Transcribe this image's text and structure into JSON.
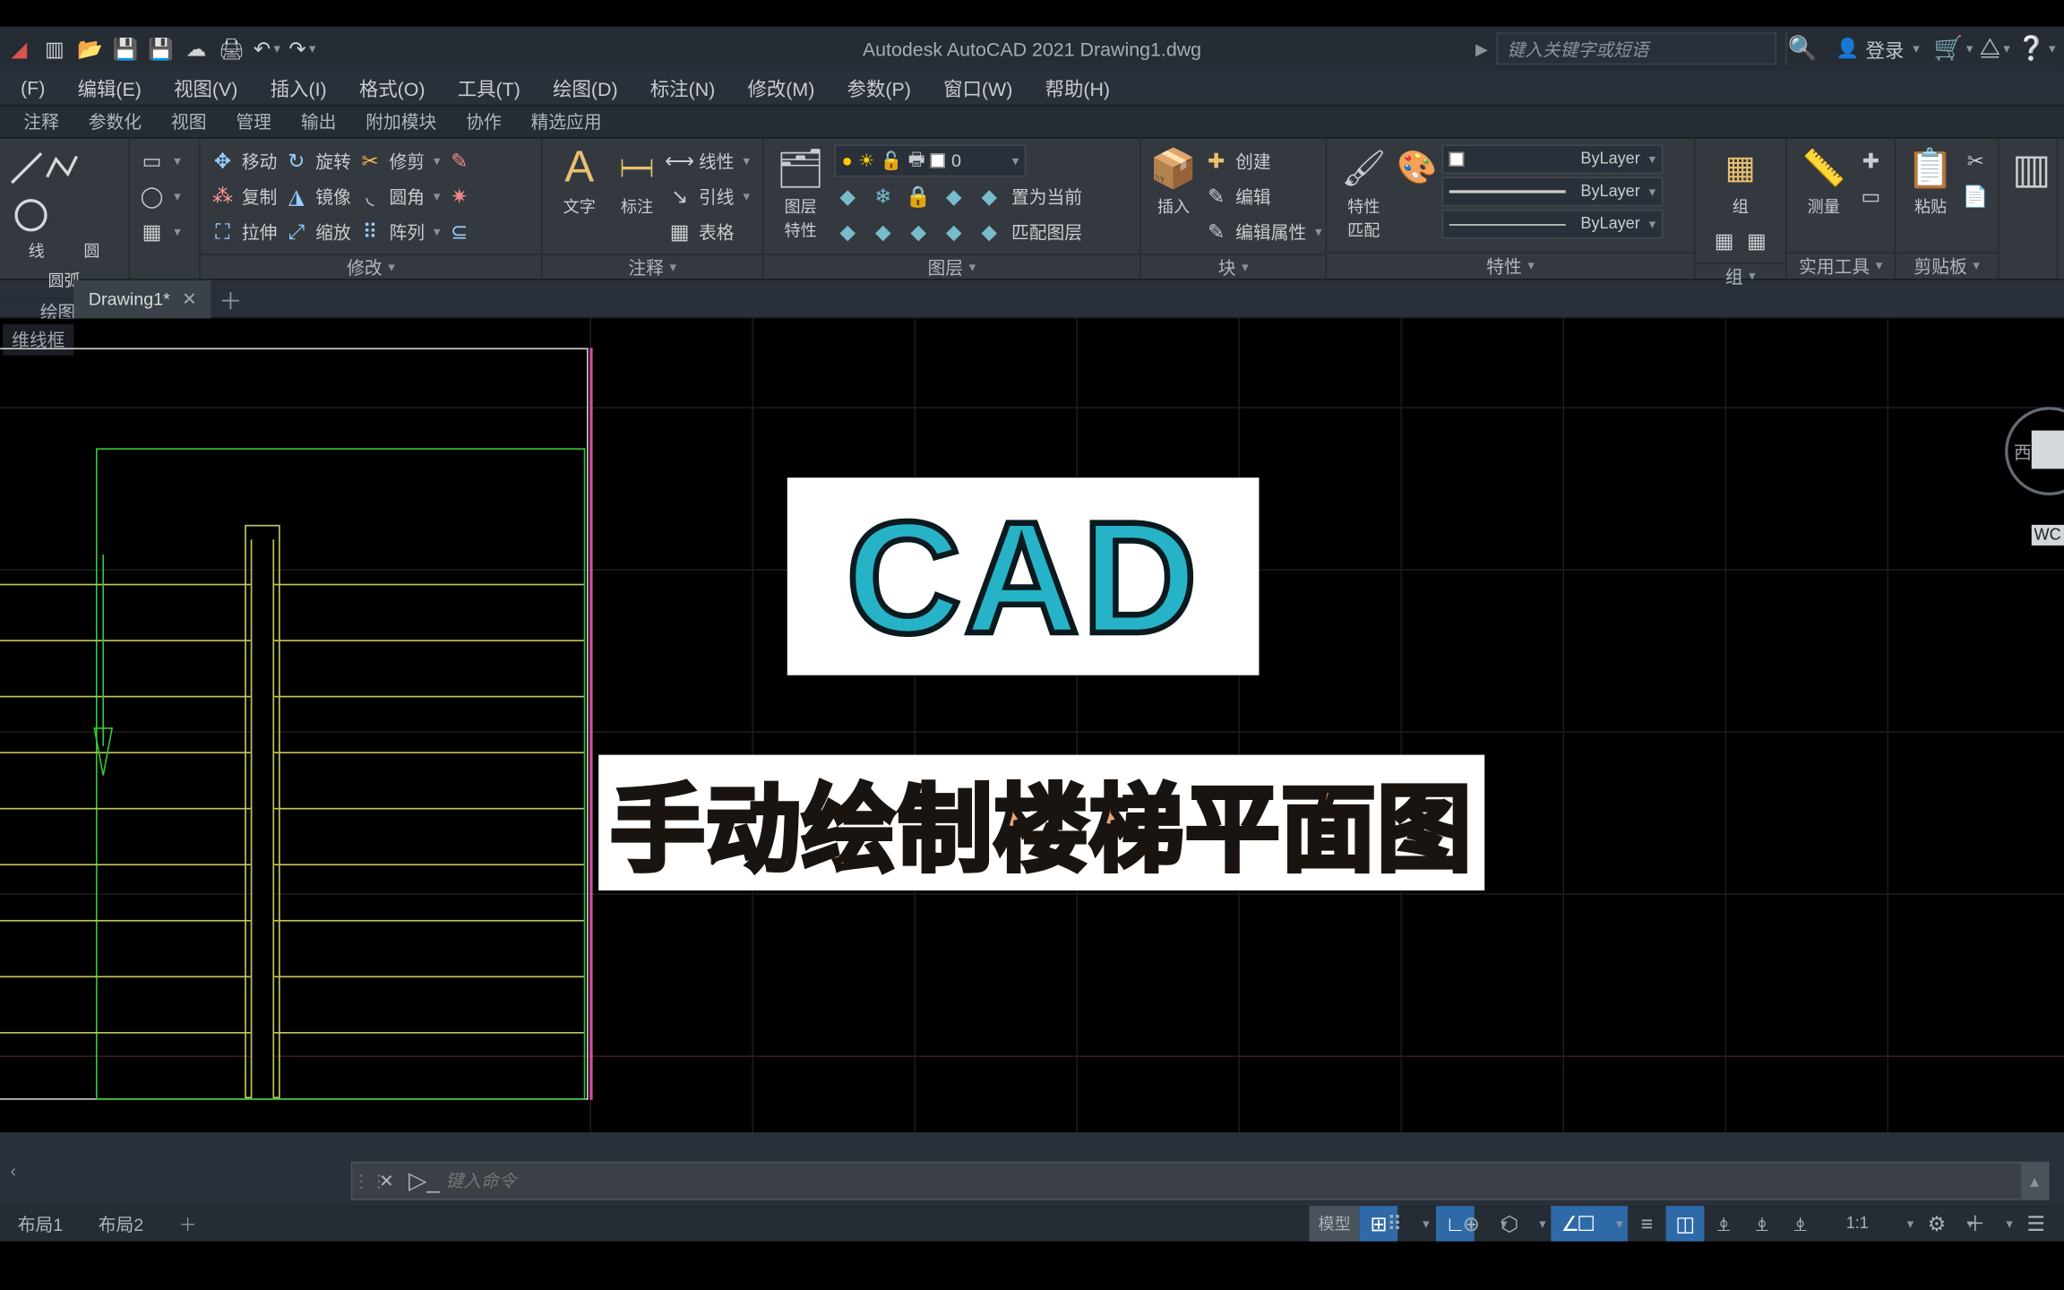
{
  "title": "Autodesk AutoCAD 2021   Drawing1.dwg",
  "search": {
    "placeholder": "键入关键字或短语",
    "login": "登录"
  },
  "menubar": [
    "(F)",
    "编辑(E)",
    "视图(V)",
    "插入(I)",
    "格式(O)",
    "工具(T)",
    "绘图(D)",
    "标注(N)",
    "修改(M)",
    "参数(P)",
    "窗口(W)",
    "帮助(H)"
  ],
  "ribtabs": [
    "注释",
    "参数化",
    "视图",
    "管理",
    "输出",
    "附加模块",
    "协作",
    "精选应用"
  ],
  "panels": {
    "draw": {
      "label": "绘图",
      "items": [
        "线",
        "圆",
        "圆弧"
      ]
    },
    "modify": {
      "label": "修改",
      "items": [
        {
          "icon": "move",
          "text": "移动"
        },
        {
          "icon": "rotate",
          "text": "旋转"
        },
        {
          "icon": "trim",
          "text": "修剪"
        },
        {
          "icon": "copy",
          "text": "复制"
        },
        {
          "icon": "mirror",
          "text": "镜像"
        },
        {
          "icon": "fillet",
          "text": "圆角"
        },
        {
          "icon": "stretch",
          "text": "拉伸"
        },
        {
          "icon": "scale",
          "text": "缩放"
        },
        {
          "icon": "array",
          "text": "阵列"
        }
      ]
    },
    "annotate": {
      "label": "注释",
      "text": "文字",
      "dim": "标注",
      "opts": [
        "线性",
        "引线",
        "表格"
      ]
    },
    "layers": {
      "label": "图层",
      "btn": "图层\n特性",
      "current": "0",
      "setcur": "置为当前",
      "match": "匹配图层"
    },
    "block": {
      "label": "块",
      "insert": "插入",
      "create": "创建",
      "edit": "编辑",
      "attr": "编辑属性"
    },
    "props": {
      "label": "特性",
      "btn": "特性\n匹配",
      "vals": [
        "ByLayer",
        "ByLayer",
        "ByLayer"
      ]
    },
    "group": {
      "label": "组",
      "btn": "组"
    },
    "util": {
      "label": "实用工具",
      "btn": "测量"
    },
    "clip": {
      "label": "剪贴板",
      "btn": "粘贴"
    }
  },
  "filetab": {
    "name": "Drawing1*"
  },
  "viewport": {
    "label": "维线框",
    "wcs": "WC",
    "west": "西"
  },
  "overlay": {
    "big": "CAD",
    "sub": "手动绘制楼梯平面图"
  },
  "cmd": {
    "placeholder": "键入命令"
  },
  "layouts": [
    "布局1",
    "布局2"
  ],
  "status": {
    "model": "模型",
    "scale": "1:1"
  }
}
